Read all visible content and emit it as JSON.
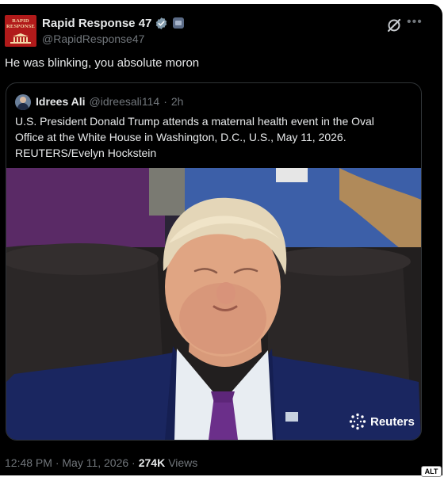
{
  "post": {
    "author": {
      "display_name": "Rapid Response 47",
      "handle": "@RapidResponse47",
      "avatar_lines": [
        "RAPID",
        "RESPONSE"
      ],
      "verified_icon": "verified-badge-icon",
      "affiliate_icon": "government-affiliate-icon"
    },
    "text": "He was blinking, you absolute moron",
    "timestamp": "12:48 PM · May 11, 2026 ·",
    "views_count": "274K",
    "views_label": "Views"
  },
  "quoted_post": {
    "author_name": "Idrees Ali",
    "author_handle": "@idreesali114",
    "separator": "·",
    "time": "2h",
    "text_lines": [
      "U.S. President Donald Trump attends a maternal health event in the Oval",
      "Office at the White House in Washington, D.C., U.S., May 11, 2026.",
      "REUTERS/Evelyn Hockstein"
    ],
    "photo_watermark": "Reuters"
  },
  "alt_badge": "ALT",
  "colors": {
    "background": "#000000",
    "primary_text": "#e7e9ea",
    "secondary_text": "#71767b",
    "border": "#2f3336",
    "verified": "#1d9bf0"
  }
}
